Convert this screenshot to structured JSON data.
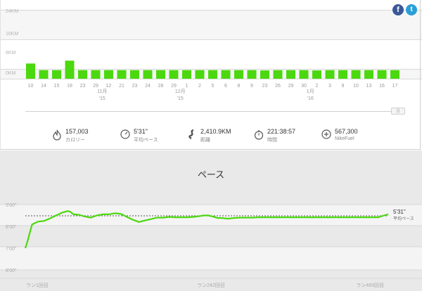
{
  "social": {
    "facebook_label": "f",
    "twitter_label": "t"
  },
  "colors": {
    "bar": "#4cd80f",
    "pace_line": "#4cd80f",
    "avg_line": "#555555"
  },
  "slider": {
    "handle_label": "|||"
  },
  "stats": [
    {
      "icon": "flame-icon",
      "value": "157,003",
      "label": "カロリー"
    },
    {
      "icon": "gauge-icon",
      "value": "5'31\"",
      "label": "平均ペース"
    },
    {
      "icon": "road-icon",
      "value": "2,410.9KM",
      "label": "距離"
    },
    {
      "icon": "stopwatch-icon",
      "value": "221:38:57",
      "label": "時間"
    },
    {
      "icon": "plus-circle-icon",
      "value": "567,300",
      "label": "NikeFuel"
    }
  ],
  "pace_title": "ペース",
  "chart_data": [
    {
      "type": "bar",
      "categories": [
        "10",
        "14",
        "15",
        "18",
        "23",
        "29",
        "12",
        "21",
        "23",
        "24",
        "28",
        "29",
        "1",
        "2",
        "5",
        "6",
        "8",
        "9",
        "23",
        "26",
        "29",
        "30",
        "2",
        "3",
        "9",
        "10",
        "13",
        "16",
        "17"
      ],
      "month_labels": [
        {
          "after_index": 6,
          "month": "11月",
          "year": "'15"
        },
        {
          "after_index": 12,
          "month": "12月",
          "year": "'15"
        },
        {
          "after_index": 22,
          "month": "1月",
          "year": "'16"
        }
      ],
      "values": [
        5.3,
        3.0,
        3.0,
        6.3,
        3.0,
        3.0,
        3.0,
        3.0,
        3.0,
        3.0,
        3.0,
        3.0,
        3.0,
        3.0,
        3.0,
        3.0,
        3.0,
        3.0,
        2.9,
        3.0,
        3.0,
        3.0,
        2.9,
        3.0,
        3.0,
        3.0,
        3.0,
        3.0,
        3.0
      ],
      "ylabel_ticks": [
        "24KM",
        "16KM",
        "8KM",
        "0KM"
      ],
      "ylim": [
        0,
        24
      ],
      "grid": true
    },
    {
      "type": "line",
      "ylabel_ticks": [
        "5'00\"",
        "6'00\"",
        "7'00\"",
        "8'00\""
      ],
      "ylim_seconds": [
        300,
        480
      ],
      "xlabel_ticks": [
        "ラン1回目",
        "ラン242回目",
        "ラン483回目"
      ],
      "average_value": "5'31\"",
      "average_label": "平均ペース",
      "average_seconds": 331,
      "points": [
        [
          1,
          420
        ],
        [
          3,
          408
        ],
        [
          10,
          355
        ],
        [
          18,
          347
        ],
        [
          26,
          345
        ],
        [
          34,
          338
        ],
        [
          42,
          330
        ],
        [
          50,
          322
        ],
        [
          57,
          318
        ],
        [
          60,
          319
        ],
        [
          65,
          327
        ],
        [
          72,
          328
        ],
        [
          80,
          333
        ],
        [
          88,
          336
        ],
        [
          96,
          330
        ],
        [
          104,
          327
        ],
        [
          112,
          327
        ],
        [
          120,
          324
        ],
        [
          128,
          326
        ],
        [
          136,
          334
        ],
        [
          144,
          342
        ],
        [
          152,
          348
        ],
        [
          160,
          344
        ],
        [
          168,
          340
        ],
        [
          176,
          336
        ],
        [
          184,
          336
        ],
        [
          192,
          334
        ],
        [
          200,
          335
        ],
        [
          208,
          335
        ],
        [
          216,
          335
        ],
        [
          224,
          334
        ],
        [
          232,
          332
        ],
        [
          238,
          330
        ],
        [
          244,
          330
        ],
        [
          250,
          333
        ],
        [
          256,
          337
        ],
        [
          262,
          337
        ],
        [
          270,
          339
        ],
        [
          278,
          337
        ],
        [
          286,
          336
        ],
        [
          294,
          336
        ],
        [
          302,
          336
        ],
        [
          310,
          335
        ],
        [
          318,
          335
        ],
        [
          326,
          335
        ],
        [
          334,
          335
        ],
        [
          342,
          335
        ],
        [
          350,
          335
        ],
        [
          358,
          335
        ],
        [
          366,
          335
        ],
        [
          374,
          335
        ],
        [
          382,
          335
        ],
        [
          390,
          335
        ],
        [
          398,
          335
        ],
        [
          406,
          335
        ],
        [
          414,
          335
        ],
        [
          422,
          335
        ],
        [
          430,
          335
        ],
        [
          438,
          335
        ],
        [
          446,
          335
        ],
        [
          454,
          335
        ],
        [
          462,
          335
        ],
        [
          470,
          335
        ],
        [
          476,
          331
        ],
        [
          483,
          327
        ]
      ],
      "x_max": 483,
      "grid": true
    }
  ]
}
